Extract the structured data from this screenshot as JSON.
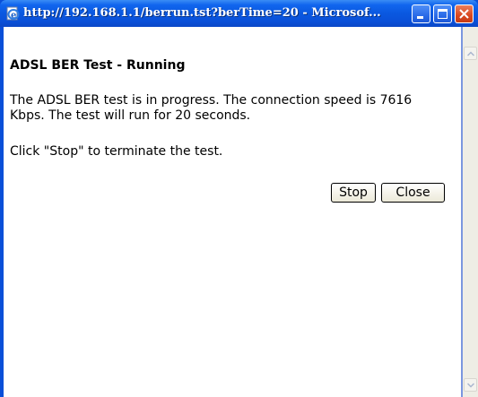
{
  "window": {
    "title": "http://192.168.1.1/berrun.tst?berTime=20 - Microsof..."
  },
  "page": {
    "heading": "ADSL BER Test - Running",
    "description": "The ADSL BER test is in progress. The connection speed is 7616 Kbps. The test will run for 20 seconds.",
    "hint": "Click \"Stop\" to terminate the test."
  },
  "buttons": {
    "stop_label": "Stop",
    "close_label": "Close"
  },
  "icons": {
    "title": "ie-page-icon",
    "minimize": "minimize-icon",
    "maximize": "maximize-icon",
    "close": "close-icon",
    "scroll_up": "scroll-up-arrow-icon",
    "scroll_down": "scroll-down-arrow-icon"
  },
  "colors": {
    "titlebar": "#0a58e0",
    "close_button": "#d9471f"
  }
}
